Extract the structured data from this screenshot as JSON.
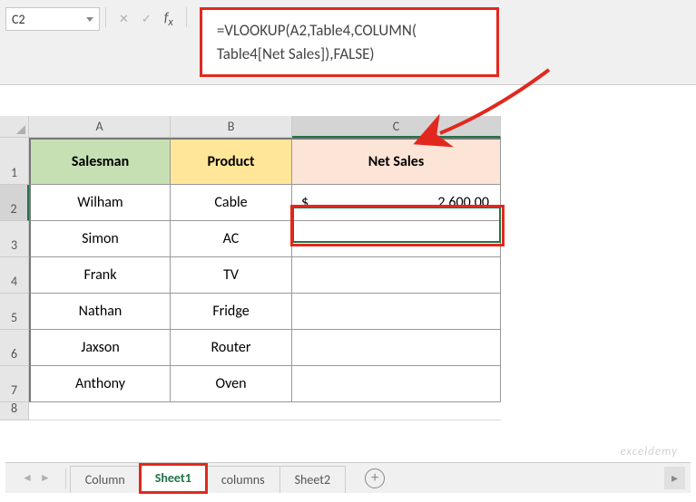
{
  "name_box": "C2",
  "formula_callout": {
    "line1": "=VLOOKUP(A2,Table4,COLUMN(",
    "line2": "Table4[Net Sales]),FALSE)"
  },
  "columns": [
    "A",
    "B",
    "C"
  ],
  "headers": {
    "A": "Salesman",
    "B": "Product",
    "C": "Net Sales"
  },
  "rows": [
    {
      "n": 1
    },
    {
      "n": 2,
      "A": "Wilham",
      "B": "Cable",
      "C_currency": "$",
      "C_value": "2,600.00"
    },
    {
      "n": 3,
      "A": "Simon",
      "B": "AC"
    },
    {
      "n": 4,
      "A": "Frank",
      "B": "TV"
    },
    {
      "n": 5,
      "A": "Nathan",
      "B": "Fridge"
    },
    {
      "n": 6,
      "A": "Jaxson",
      "B": "Router"
    },
    {
      "n": 7,
      "A": "Anthony",
      "B": "Oven"
    },
    {
      "n": 8
    }
  ],
  "tabs": {
    "items": [
      "Column",
      "Sheet1",
      "columns",
      "Sheet2"
    ],
    "active": "Sheet1"
  },
  "watermark": "exceldemy"
}
